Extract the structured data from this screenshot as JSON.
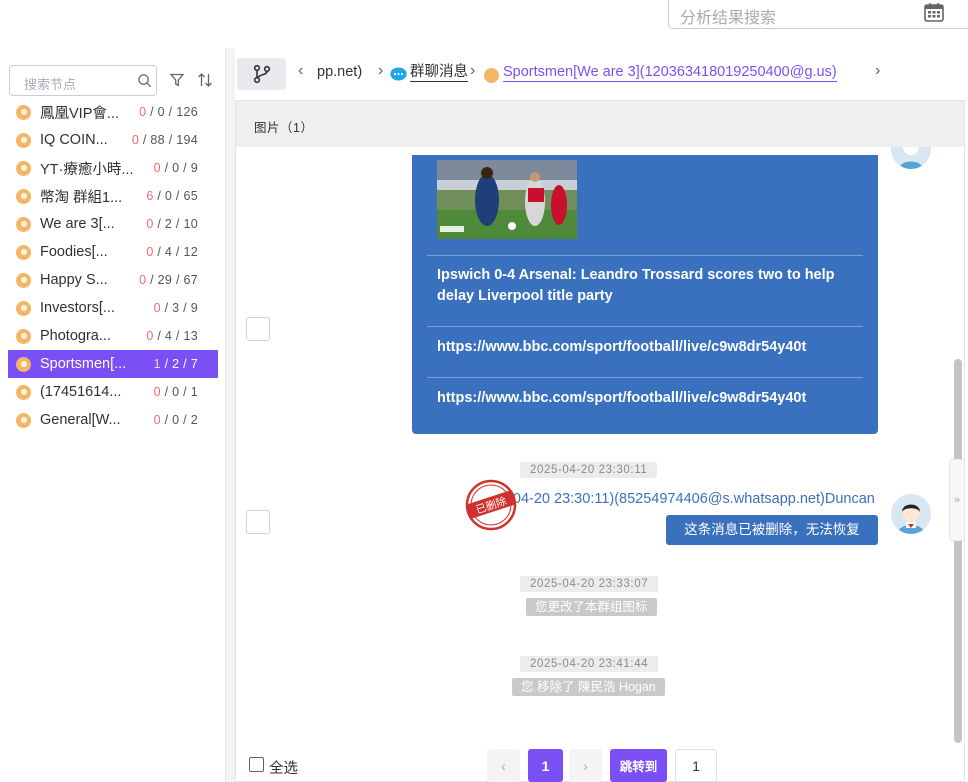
{
  "header": {
    "search_placeholder": "分析结果搜索",
    "calendar_icon": "calendar-icon"
  },
  "sidebar": {
    "search_placeholder": "搜索节点",
    "items": [
      {
        "label": "鳳凰VIP會...",
        "red": "0",
        "rest": " / 0 / 126"
      },
      {
        "label": "IQ COIN...",
        "red": "0",
        "rest": " / 88 / 194"
      },
      {
        "label": "YT·療癒小時...",
        "red": "0",
        "rest": " / 0 / 9"
      },
      {
        "label": "幣淘 群組1...",
        "red": "6",
        "rest": " / 0 / 65"
      },
      {
        "label": "We are 3[...",
        "red": "0",
        "rest": " / 2 / 10"
      },
      {
        "label": "Foodies[...",
        "red": "0",
        "rest": " / 4 / 12"
      },
      {
        "label": "Happy S...",
        "red": "0",
        "rest": " / 29 / 67"
      },
      {
        "label": "Investors[...",
        "red": "0",
        "rest": " / 3 / 9"
      },
      {
        "label": "Photogra...",
        "red": "0",
        "rest": " / 4 / 13"
      },
      {
        "label": "Sportsmen[...",
        "red": "1",
        "rest": " / 2 / 7"
      },
      {
        "label": "(17451614...",
        "red": "0",
        "rest": " / 0 / 1"
      },
      {
        "label": "General[W...",
        "red": "0",
        "rest": " / 0 / 2"
      }
    ]
  },
  "breadcrumb": {
    "part1": "pp.net)",
    "part2": "群聊消息",
    "part3": "Sportsmen[We are 3](120363418019250400@g.us)"
  },
  "panel": {
    "title": "图片（1）"
  },
  "message_card": {
    "headline": "Ipswich 0-4 Arsenal: Leandro Trossard scores two to help delay Liverpool title party",
    "link1": "https://www.bbc.com/sport/football/live/c9w8dr54y40t",
    "link2": "https://www.bbc.com/sport/football/live/c9w8dr54y40t"
  },
  "messages": {
    "ts1": "2025-04-20 23:30:11",
    "sender": "(2025-04-20 23:30:11)(85254974406@s.whatsapp.net)Duncan",
    "deleted_text": "这条消息已被删除，无法恢复",
    "stamp_text": "已删除",
    "ts2": "2025-04-20 23:33:07",
    "sys2": "您更改了本群组图标",
    "ts3": "2025-04-20 23:41:44",
    "sys3": "您 移除了 陳民浩 Hogan"
  },
  "footer": {
    "select_all": "全选",
    "page": "1",
    "jump_label": "跳转到",
    "jump_value": "1"
  },
  "colors": {
    "accent": "#7b4ff6",
    "bubble": "#3a71bf",
    "badge_red": "#f56c6c"
  }
}
